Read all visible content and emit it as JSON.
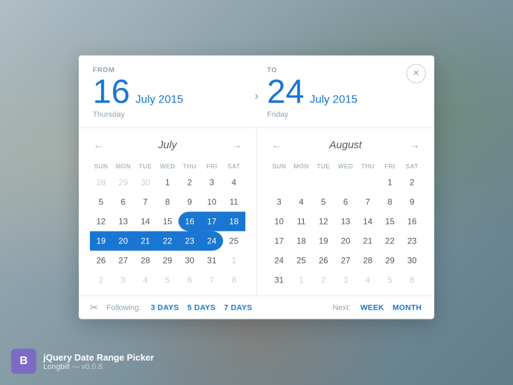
{
  "background": {
    "color_start": "#b0bec5",
    "color_end": "#607d8b"
  },
  "modal": {
    "from_label": "FROM",
    "to_label": "TO",
    "from_day_num": "16",
    "from_month_year": "July 2015",
    "from_day_name": "Thursday",
    "to_day_num": "24",
    "to_month_year": "July 2015",
    "to_day_name": "Friday",
    "close_icon": "×"
  },
  "july_calendar": {
    "month_label": "July",
    "prev_icon": "←",
    "next_icon": "→",
    "day_headers": [
      "SUN",
      "MON",
      "TUE",
      "WED",
      "THU",
      "FRI",
      "SAT"
    ],
    "weeks": [
      [
        "28",
        "29",
        "30",
        "1",
        "2",
        "3",
        "4"
      ],
      [
        "5",
        "6",
        "7",
        "8",
        "9",
        "10",
        "11"
      ],
      [
        "12",
        "13",
        "14",
        "15",
        "16",
        "17",
        "18"
      ],
      [
        "19",
        "20",
        "21",
        "22",
        "23",
        "24",
        "25"
      ],
      [
        "26",
        "27",
        "28",
        "29",
        "30",
        "31",
        "1"
      ],
      [
        "2",
        "3",
        "4",
        "5",
        "6",
        "7",
        "8"
      ]
    ],
    "week_states": [
      [
        "other",
        "other",
        "other",
        "",
        "",
        "",
        ""
      ],
      [
        "",
        "",
        "",
        "",
        "",
        "",
        ""
      ],
      [
        "",
        "",
        "",
        "",
        "sel-start",
        "in-range",
        "in-range"
      ],
      [
        "in-range",
        "in-range",
        "in-range",
        "in-range",
        "in-range",
        "sel-end",
        ""
      ],
      [
        "",
        "",
        "",
        "",
        "",
        "",
        "other"
      ],
      [
        "other",
        "other",
        "other",
        "other",
        "other",
        "other",
        "other"
      ]
    ]
  },
  "august_calendar": {
    "month_label": "August",
    "prev_icon": "←",
    "next_icon": "→",
    "day_headers": [
      "SUN",
      "MON",
      "TUE",
      "WED",
      "THU",
      "FRI",
      "SAT"
    ],
    "weeks": [
      [
        "",
        "",
        "",
        "",
        "",
        "1",
        "2"
      ],
      [
        "3",
        "4",
        "5",
        "6",
        "7",
        "8",
        "9"
      ],
      [
        "10",
        "11",
        "12",
        "13",
        "14",
        "15",
        "16"
      ],
      [
        "17",
        "18",
        "19",
        "20",
        "21",
        "22",
        "23"
      ],
      [
        "24",
        "25",
        "26",
        "27",
        "28",
        "29",
        "30"
      ],
      [
        "31",
        "1",
        "2",
        "3",
        "4",
        "5",
        "6"
      ]
    ],
    "week_states": [
      [
        "other",
        "other",
        "other",
        "other",
        "other",
        "",
        ""
      ],
      [
        "",
        "",
        "",
        "",
        "",
        "",
        ""
      ],
      [
        "",
        "",
        "",
        "",
        "",
        "",
        ""
      ],
      [
        "",
        "",
        "",
        "",
        "",
        "",
        ""
      ],
      [
        "",
        "",
        "",
        "",
        "",
        "",
        ""
      ],
      [
        "",
        "other",
        "other",
        "other",
        "other",
        "other",
        "other"
      ]
    ]
  },
  "footer": {
    "icon": "✂",
    "following_label": "Following:",
    "btn_3days": "3 DAYS",
    "btn_5days": "5 DAYS",
    "btn_7days": "7 DAYS",
    "next_label": "Next:",
    "btn_week": "WEEK",
    "btn_month": "MONTH"
  },
  "badge": {
    "letter": "B",
    "title": "jQuery Date Range Picker",
    "subtitle": "Longbill",
    "version": "— v0.0.8"
  }
}
